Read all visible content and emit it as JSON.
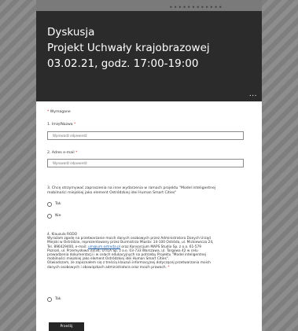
{
  "header": {
    "title_line1": "Dyskusja",
    "title_line2": "Projekt Uchwały krajobrazowej",
    "title_line3": "03.02.21, godz. 17:00-19:00",
    "more_dots": "..."
  },
  "form": {
    "required_note": "Wymagane",
    "q1_label": "1. Imię/Nazwa",
    "q1_placeholder": "Wprowadź odpowiedź",
    "q2_label": "2. Adres e-mail",
    "q2_placeholder": "Wprowadź odpowiedź",
    "q3_label_a": "3. Chcę otrzymywać zaproszenia na inne wydarzenia w ramach projektu \"Model inteligentnej",
    "q3_label_b": "mobilności miejskiej jako element Ostródzkiej idei Human Smart Cities\"",
    "q3_option_yes": "Tak",
    "q3_option_no": "Nie",
    "q4_title": "4. Klauzula RODO",
    "q4_text_a": "Wyrażam zgodę na przetwarzanie moich danych osobowych przez Administratora Danych Urząd",
    "q4_text_b": "Miejski w Ostródzie, reprezentowany przez Burmistrza Miasta: 14-100 Ostróda, ul. Mickiewicza 24,",
    "q4_text_c_pre": "Tel. 896429400, e-mail: ",
    "q4_text_c_link": "um@um.ostroda.pl",
    "q4_text_c_post": " oraz Konsorcjum MAPS Studio Sp. z o.o. 61-579",
    "q4_text_d": "Poznań, ul. Przemysłowa 33/34; UTILA Sp. z o.o. 03-733 Warszawa, ul. Targowa 42 w celu",
    "q4_text_e": "prowadzenia dokumentacji i w celach edukacyjnych na potrzeby Projektu \"Model inteligentnej",
    "q4_text_f": "mobilności miejskiej jako element Ostródzkiej idei Human Smart Cities\".",
    "q4_text_g": "Oświadczam, że zapoznałem się z treścią klauzuli informacyjnej dotyczącej przetwarzania moich",
    "q4_text_h": "danych osobowych i obowiązkach administratora oraz moich prawach.",
    "q4_option_yes": "Tak",
    "submit_label": "Prześlij",
    "required_mark": "*"
  },
  "colors": {
    "header_bg": "#2b2b2b",
    "required": "#c4262e",
    "link": "#1a5fb4",
    "submit_bg": "#262626"
  }
}
